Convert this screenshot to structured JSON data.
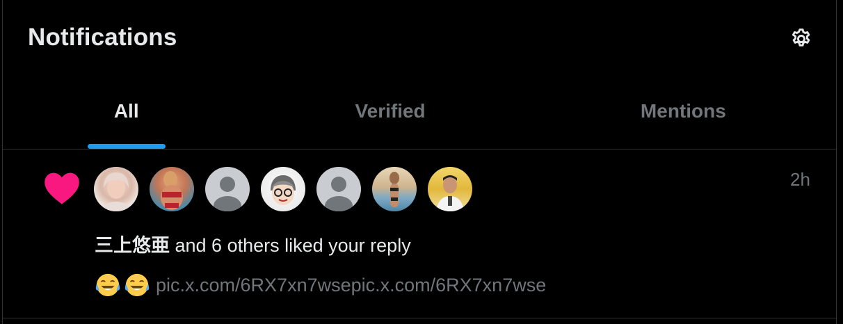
{
  "header": {
    "title": "Notifications"
  },
  "tabs": [
    {
      "label": "All",
      "active": true
    },
    {
      "label": "Verified",
      "active": false
    },
    {
      "label": "Mentions",
      "active": false
    }
  ],
  "notification": {
    "type_icon": "heart-icon",
    "avatars": [
      {
        "kind": "photo"
      },
      {
        "kind": "photo"
      },
      {
        "kind": "default-placeholder"
      },
      {
        "kind": "cartoon"
      },
      {
        "kind": "default-placeholder"
      },
      {
        "kind": "photo"
      },
      {
        "kind": "photo"
      }
    ],
    "time": "2h",
    "actor_name": "三上悠亜",
    "action_text": " and 6 others liked your reply",
    "emojis": "😂😂",
    "content_link": "pic.x.com/6RX7xn7wsepic.x.com/6RX7xn7wse"
  },
  "colors": {
    "background": "#000000",
    "text_primary": "#e7e9ea",
    "text_secondary": "#71767b",
    "accent_blue": "#1d9bf0",
    "like_pink": "#f91880",
    "border": "#2f3336"
  }
}
